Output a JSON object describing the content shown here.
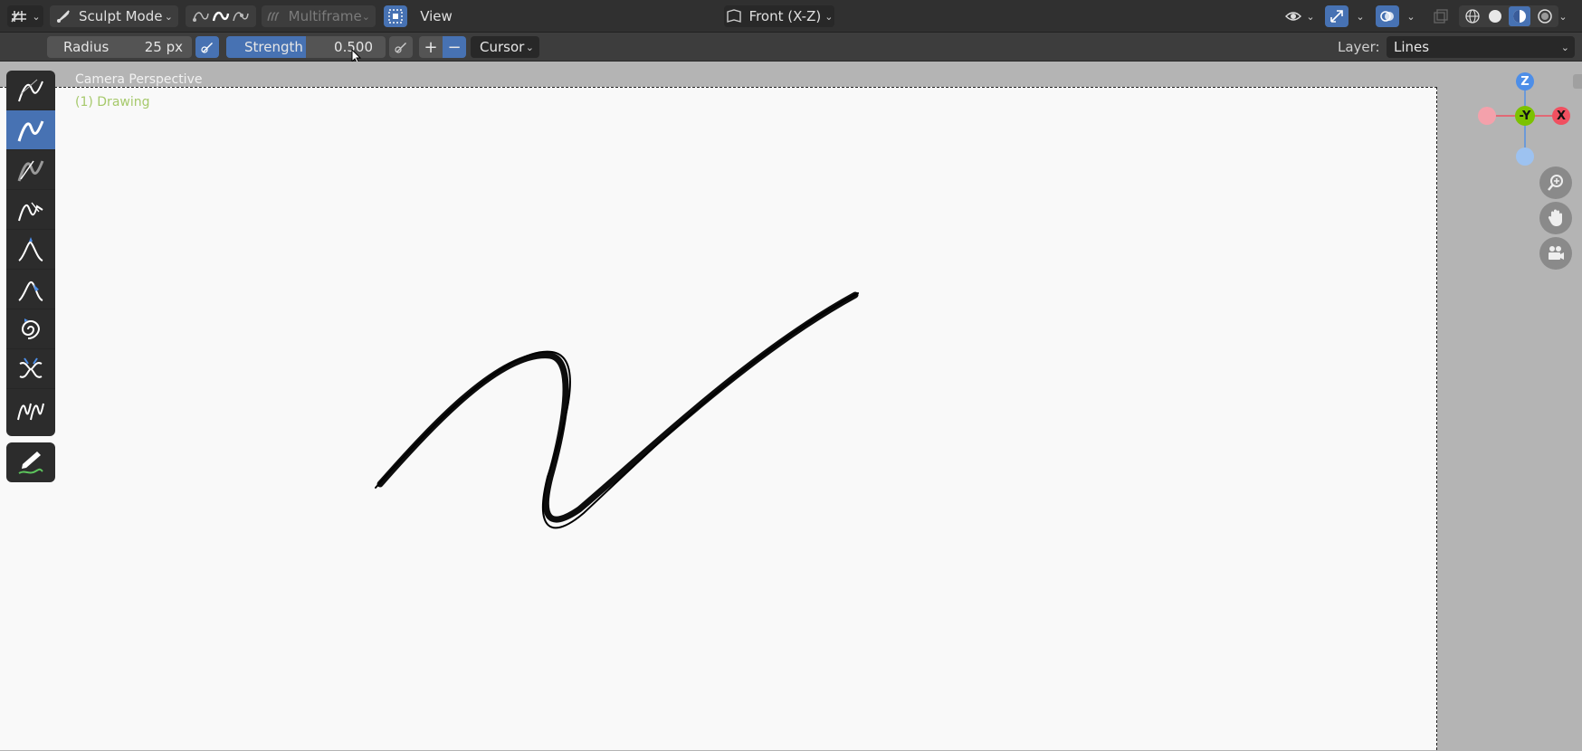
{
  "header": {
    "mode_label": "Sculpt Mode",
    "multiframe_label": "Multiframe",
    "view_menu": "View",
    "view_orientation": "Front (X-Z)"
  },
  "tool_settings": {
    "radius_label": "Radius",
    "radius_value": "25 px",
    "strength_label": "Strength",
    "strength_value": "0.500",
    "plus": "+",
    "minus": "−",
    "falloff_label": "Cursor",
    "layer_label": "Layer:",
    "layer_value": "Lines"
  },
  "viewport": {
    "perspective_text": "Camera Perspective",
    "object_text": "(1) Drawing"
  },
  "toolshelf": {
    "active_index": 1,
    "tools": [
      "smooth-brush",
      "thickness-brush",
      "strength-brush",
      "randomize-brush",
      "grab-brush",
      "push-brush",
      "twist-brush",
      "pinch-brush",
      "clone-brush"
    ],
    "bottom_tool": "annotate"
  },
  "gizmo": {
    "z_label": "Z",
    "neg_y_label": "-Y",
    "x_label": "X",
    "colors": {
      "x": "#f05060",
      "y": "#7cc200",
      "z": "#4d8ee8"
    }
  }
}
